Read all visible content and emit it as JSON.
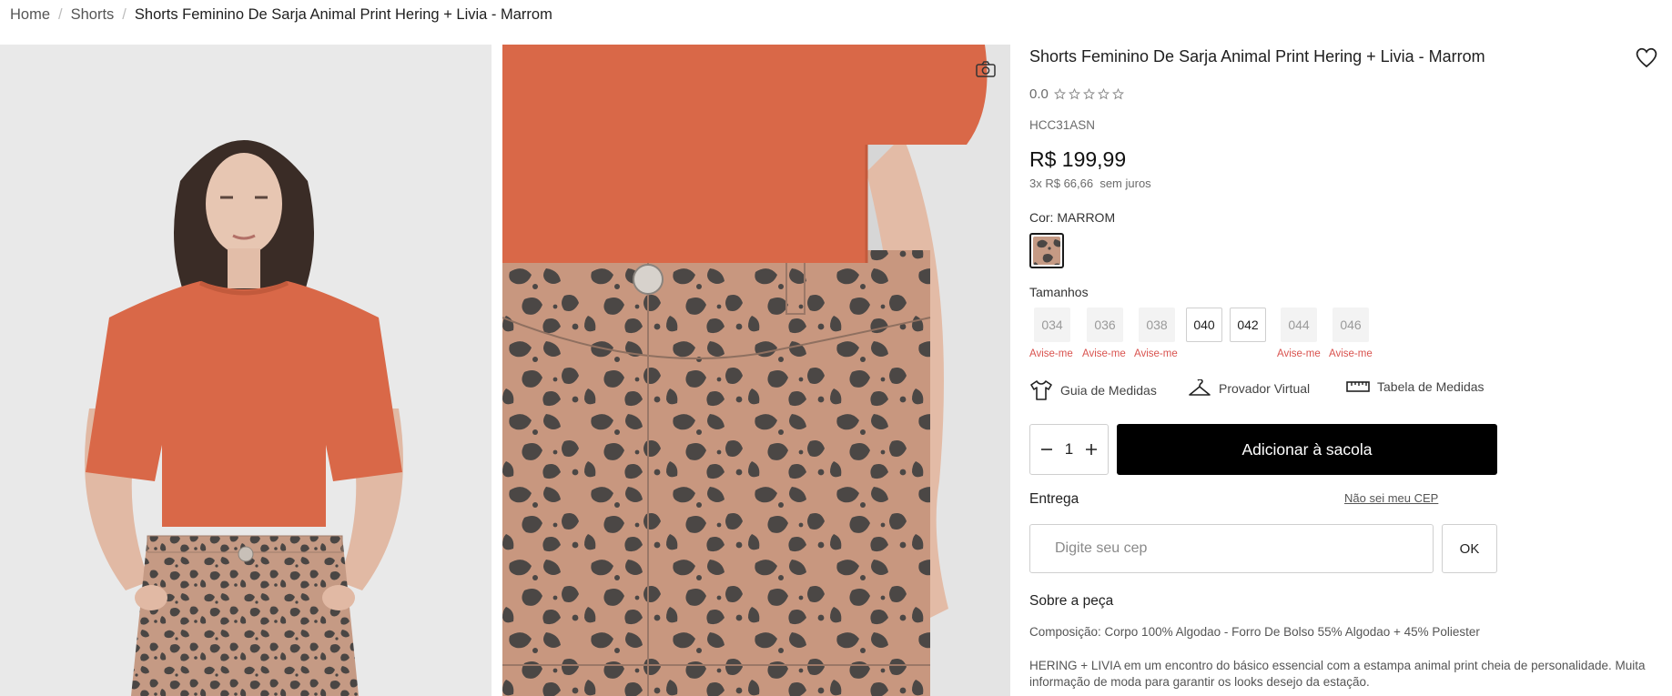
{
  "breadcrumb": {
    "items": [
      "Home",
      "Shorts"
    ],
    "current": "Shorts Feminino De Sarja Animal Print Hering + Livia - Marrom"
  },
  "product": {
    "title": "Shorts Feminino De Sarja Animal Print Hering + Livia - Marrom",
    "rating_value": "0.0",
    "stars_total": 5,
    "sku": "HCC31ASN",
    "price": "R$ 199,99",
    "installments": "3x R$ 66,66  sem juros",
    "color_label": "Cor: MARROM",
    "swatch_color": "#b08a78"
  },
  "sizes": {
    "label": "Tamanhos",
    "items": [
      {
        "label": "034",
        "available": false,
        "notify": "Avise-me"
      },
      {
        "label": "036",
        "available": false,
        "notify": "Avise-me"
      },
      {
        "label": "038",
        "available": false,
        "notify": "Avise-me"
      },
      {
        "label": "040",
        "available": true,
        "notify": ""
      },
      {
        "label": "042",
        "available": true,
        "notify": ""
      },
      {
        "label": "044",
        "available": false,
        "notify": "Avise-me"
      },
      {
        "label": "046",
        "available": false,
        "notify": "Avise-me"
      }
    ]
  },
  "measures": {
    "guide": "Guia de Medidas",
    "virtual": "Provador Virtual",
    "table": "Tabela de Medidas"
  },
  "cart": {
    "quantity": "1",
    "add_label": "Adicionar à sacola"
  },
  "delivery": {
    "label": "Entrega",
    "unknown_cep": "Não sei meu CEP",
    "cep_placeholder": "Digite seu cep",
    "ok_label": "OK"
  },
  "about": {
    "title": "Sobre a peça",
    "composition": "Composição: Corpo 100% Algodao - Forro De Bolso 55% Algodao + 45% Poliester",
    "description": "HERING + LIVIA em um encontro do básico essencial com a estampa animal print cheia de personalidade. Muita informação de moda para garantir os looks desejo da estação."
  },
  "colors": {
    "accent": "#000000",
    "notify": "#d9534f",
    "tshirt": "#d96848",
    "leopard_base": "#c79880",
    "leopard_spot": "#4c4845"
  }
}
